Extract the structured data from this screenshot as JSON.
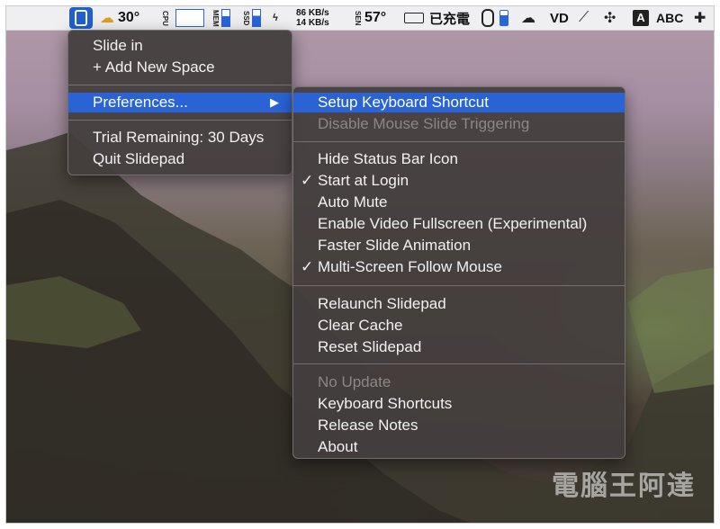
{
  "menubar": {
    "temperature": "30°",
    "cpu_label": "CPU",
    "mem_label": "MEM",
    "ssd_label": "SSD",
    "net_up": "86 KB/s",
    "net_down": "14 KB/s",
    "sen_label": "SEN",
    "sensor_temp": "57°",
    "charging_text": "已充電",
    "input_letter": "A",
    "input_source": "ABC"
  },
  "app_menu": {
    "items": [
      {
        "label": "Slide in"
      },
      {
        "label": "+ Add New Space"
      },
      {
        "label": "Preferences..."
      },
      {
        "label": "Trial Remaining: 30 Days"
      },
      {
        "label": "Quit Slidepad"
      }
    ],
    "submenu_arrow": "▶"
  },
  "preferences_submenu": {
    "check_glyph": "✓",
    "items": [
      {
        "label": "Setup Keyboard Shortcut"
      },
      {
        "label": "Disable Mouse Slide Triggering"
      },
      {
        "label": "Hide Status Bar Icon"
      },
      {
        "label": "Start at Login"
      },
      {
        "label": "Auto Mute"
      },
      {
        "label": "Enable Video Fullscreen (Experimental)"
      },
      {
        "label": "Faster Slide Animation"
      },
      {
        "label": "Multi-Screen Follow Mouse"
      },
      {
        "label": "Relaunch Slidepad"
      },
      {
        "label": "Clear Cache"
      },
      {
        "label": "Reset Slidepad"
      },
      {
        "label": "No Update"
      },
      {
        "label": "Keyboard Shortcuts"
      },
      {
        "label": "Release Notes"
      },
      {
        "label": "About"
      }
    ]
  },
  "watermark": "電腦王阿達",
  "colors": {
    "highlight": "#2a63d6",
    "menu_bg": "#443e3e",
    "menubar_bg": "#efeff1"
  }
}
